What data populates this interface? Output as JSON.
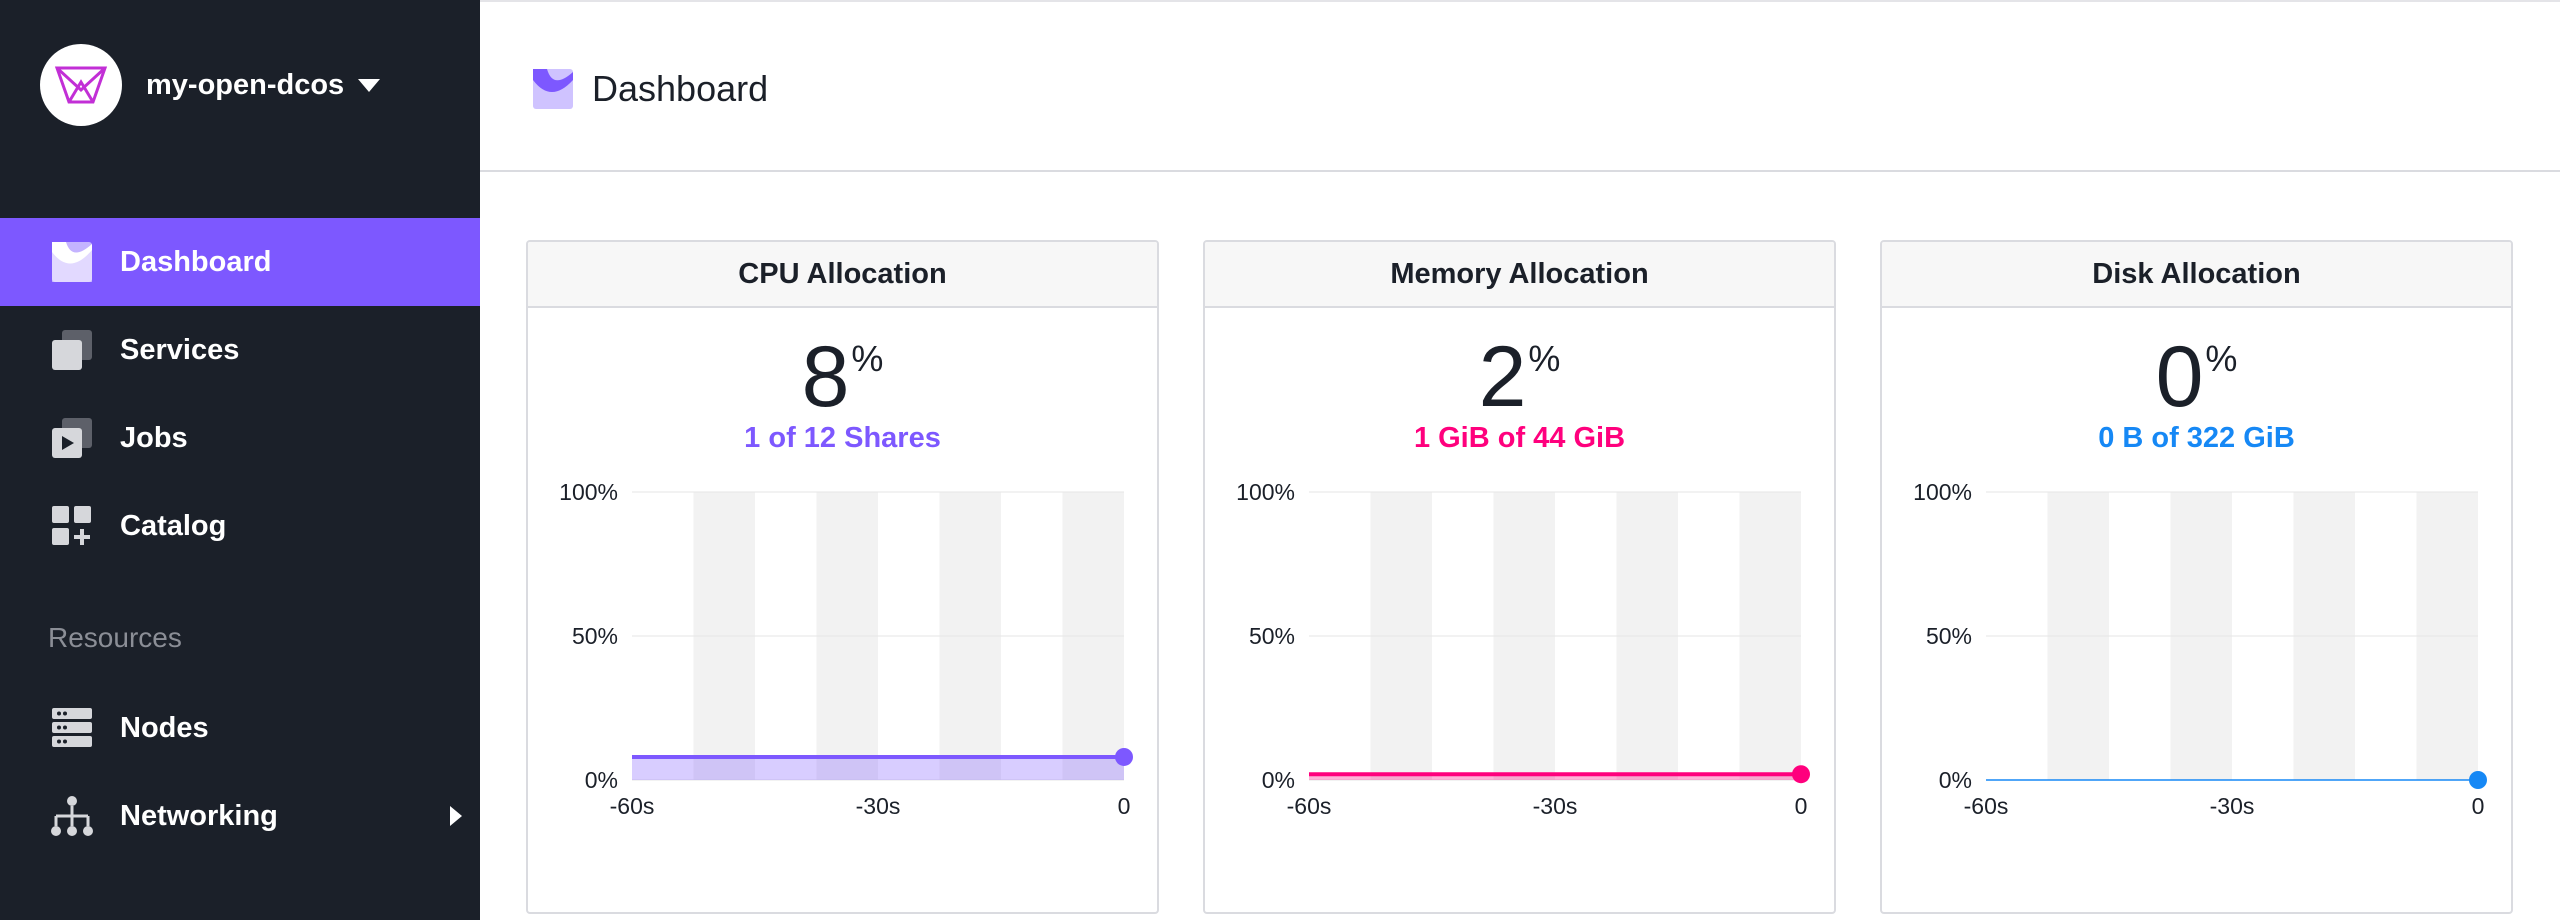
{
  "cluster": {
    "name": "my-open-dcos"
  },
  "sidebar": {
    "items": [
      {
        "label": "Dashboard"
      },
      {
        "label": "Services"
      },
      {
        "label": "Jobs"
      },
      {
        "label": "Catalog"
      },
      {
        "label": "Nodes"
      },
      {
        "label": "Networking"
      }
    ],
    "section_label": "Resources"
  },
  "header": {
    "title": "Dashboard"
  },
  "panels": [
    {
      "title": "CPU Allocation",
      "percent": "8",
      "percent_sign": "%",
      "detail": "1 of 12 Shares",
      "color": "#7d58ff"
    },
    {
      "title": "Memory Allocation",
      "percent": "2",
      "percent_sign": "%",
      "detail": "1 GiB of 44 GiB",
      "color": "#ff007d"
    },
    {
      "title": "Disk Allocation",
      "percent": "0",
      "percent_sign": "%",
      "detail": "0 B of 322 GiB",
      "color": "#1688f5"
    }
  ],
  "chart_data": [
    {
      "type": "area",
      "x": [
        -60,
        0
      ],
      "values": [
        8,
        8
      ],
      "ylim": [
        0,
        100
      ],
      "yticks": [
        "100%",
        "50%",
        "0%"
      ],
      "xticks": [
        "-60s",
        "-30s",
        "0"
      ],
      "color": "#7d58ff"
    },
    {
      "type": "area",
      "x": [
        -60,
        0
      ],
      "values": [
        2,
        2
      ],
      "ylim": [
        0,
        100
      ],
      "yticks": [
        "100%",
        "50%",
        "0%"
      ],
      "xticks": [
        "-60s",
        "-30s",
        "0"
      ],
      "color": "#ff007d"
    },
    {
      "type": "area",
      "x": [
        -60,
        0
      ],
      "values": [
        0,
        0
      ],
      "ylim": [
        0,
        100
      ],
      "yticks": [
        "100%",
        "50%",
        "0%"
      ],
      "xticks": [
        "-60s",
        "-30s",
        "0"
      ],
      "color": "#1688f5"
    }
  ]
}
